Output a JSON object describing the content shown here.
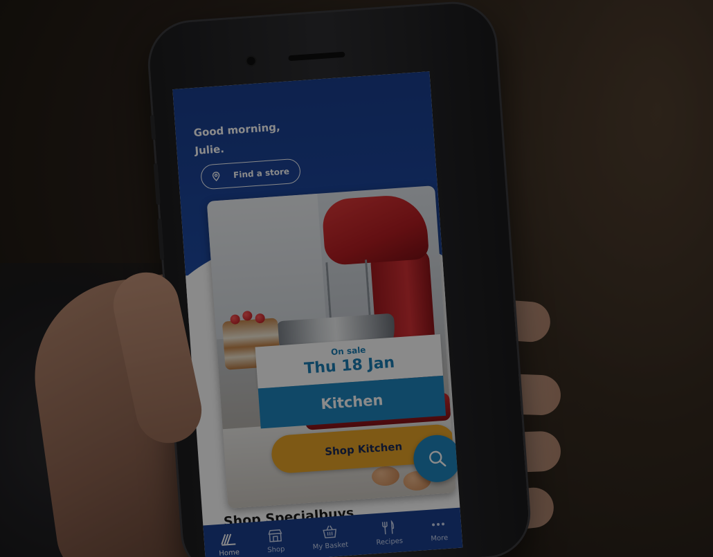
{
  "screen": {
    "greeting": "Good morning,",
    "user_name": "Julie.",
    "store_button": "Find a store",
    "promo": {
      "sale_label": "On sale",
      "sale_date": "Thu 18 Jan",
      "category": "Kitchen",
      "cta": "Shop Kitchen"
    },
    "section_title": "Shop Specialbuys",
    "tabs": [
      {
        "label": "Home",
        "icon": "home-logo-icon",
        "active": true
      },
      {
        "label": "Shop",
        "icon": "storefront-icon",
        "active": false
      },
      {
        "label": "My Basket",
        "icon": "basket-icon",
        "active": false
      },
      {
        "label": "Recipes",
        "icon": "cutlery-icon",
        "active": false
      },
      {
        "label": "More",
        "icon": "more-dots-icon",
        "active": false
      }
    ]
  },
  "colors": {
    "header_blue": "#1a3f8f",
    "accent_blue": "#1f86bf",
    "cta_orange": "#e9a528"
  }
}
